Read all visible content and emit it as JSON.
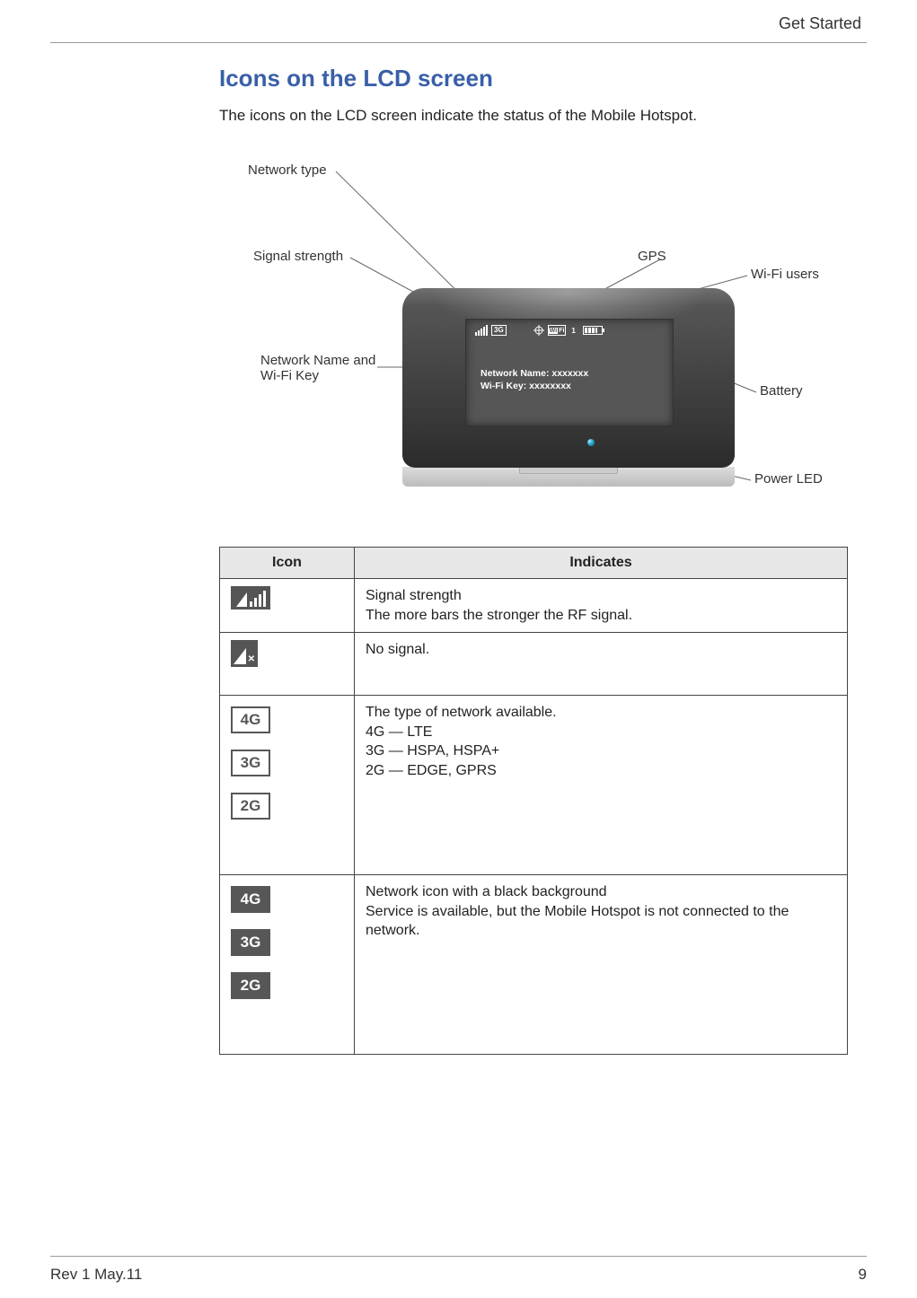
{
  "header": {
    "section": "Get Started"
  },
  "title": "Icons on the LCD screen",
  "intro": "The icons on the LCD screen indicate the status of the Mobile Hotspot.",
  "diagram": {
    "labels": {
      "network_type": "Network type",
      "signal_strength": "Signal strength",
      "network_name_key": "Network Name and\nWi-Fi Key",
      "gps": "GPS",
      "wifi_users": "Wi-Fi users",
      "battery": "Battery",
      "power_led": "Power LED"
    },
    "lcd": {
      "net_badge": "3G",
      "wifi_badge_left": "Wi",
      "wifi_badge_right": "Fi",
      "wifi_users_count": "1",
      "line1": "Network Name: xxxxxxx",
      "line2": "Wi-Fi   Key: xxxxxxxx"
    }
  },
  "table": {
    "headers": {
      "icon": "Icon",
      "indicates": "Indicates"
    },
    "rows": [
      {
        "icon_type": "signal-bars",
        "lines": [
          "Signal strength",
          "The more bars the stronger the RF signal."
        ]
      },
      {
        "icon_type": "no-signal",
        "lines": [
          "No signal."
        ]
      },
      {
        "icon_type": "net-white",
        "icon_labels": [
          "4G",
          "3G",
          "2G"
        ],
        "lines": [
          "The type of network available.",
          "4G — LTE",
          "3G — HSPA, HSPA+",
          "2G — EDGE, GPRS"
        ]
      },
      {
        "icon_type": "net-dark",
        "icon_labels": [
          "4G",
          "3G",
          "2G"
        ],
        "lines": [
          "Network icon with a black background",
          "Service is available, but the Mobile Hotspot is not connected to the network."
        ]
      }
    ]
  },
  "footer": {
    "left": "Rev 1  May.11",
    "right": "9"
  }
}
